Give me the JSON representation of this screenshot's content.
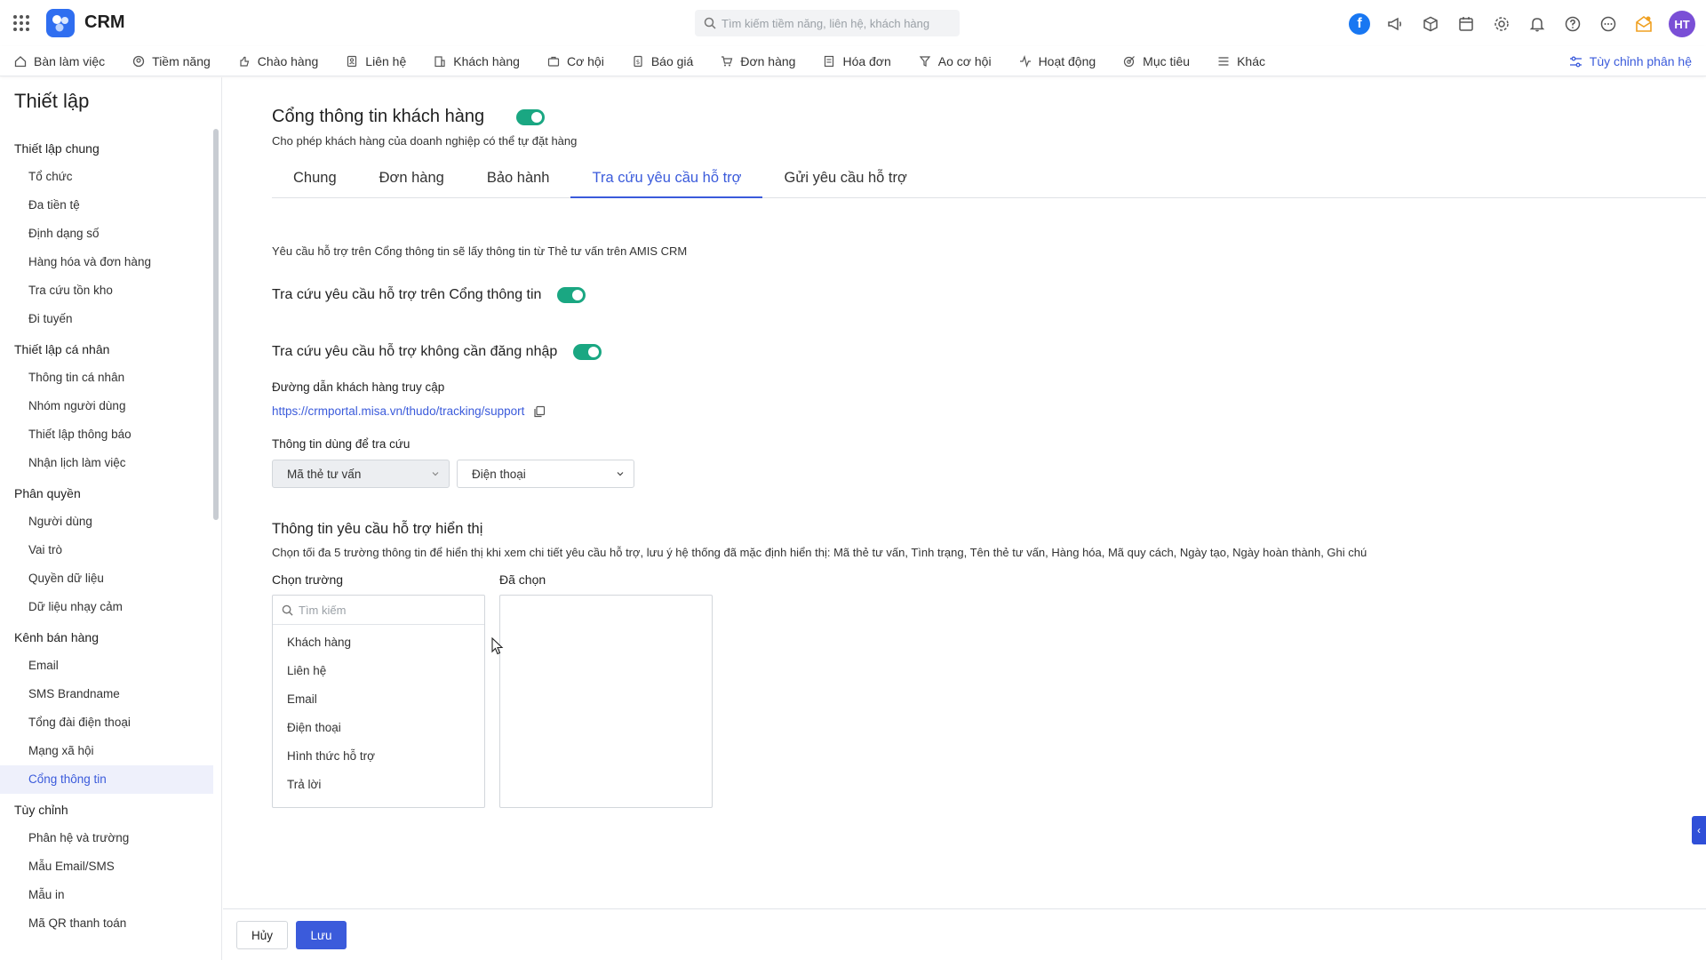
{
  "app": {
    "title": "CRM"
  },
  "search": {
    "placeholder": "Tìm kiếm tiềm năng, liên hệ, khách hàng"
  },
  "user": {
    "initials": "HT"
  },
  "colors": {
    "accent": "#3b5bdb",
    "toggle_on": "#1aa782",
    "brand": "#2f6ef0"
  },
  "nav": {
    "items": [
      {
        "label": "Bàn làm việc",
        "icon": "home-icon"
      },
      {
        "label": "Tiềm năng",
        "icon": "target-icon"
      },
      {
        "label": "Chào hàng",
        "icon": "hand-icon"
      },
      {
        "label": "Liên hệ",
        "icon": "contact-icon"
      },
      {
        "label": "Khách hàng",
        "icon": "building-icon"
      },
      {
        "label": "Cơ hội",
        "icon": "briefcase-icon"
      },
      {
        "label": "Báo giá",
        "icon": "quote-icon"
      },
      {
        "label": "Đơn hàng",
        "icon": "cart-icon"
      },
      {
        "label": "Hóa đơn",
        "icon": "invoice-icon"
      },
      {
        "label": "Ao cơ hội",
        "icon": "funnel-icon"
      },
      {
        "label": "Hoạt động",
        "icon": "activity-icon"
      },
      {
        "label": "Mục tiêu",
        "icon": "goal-icon"
      },
      {
        "label": "Khác",
        "icon": "menu-icon"
      }
    ],
    "customize_label": "Tùy chỉnh phân hệ"
  },
  "sidebar": {
    "title": "Thiết lập",
    "groups": [
      {
        "label": "Thiết lập chung",
        "items": [
          "Tổ chức",
          "Đa tiền tệ",
          "Định dạng số",
          "Hàng hóa và đơn hàng",
          "Tra cứu tồn kho",
          "Đi tuyến"
        ]
      },
      {
        "label": "Thiết lập cá nhân",
        "items": [
          "Thông tin cá nhân",
          "Nhóm người dùng",
          "Thiết lập thông báo",
          "Nhận lịch làm việc"
        ]
      },
      {
        "label": "Phân quyền",
        "items": [
          "Người dùng",
          "Vai trò",
          "Quyền dữ liệu",
          "Dữ liệu nhạy cảm"
        ]
      },
      {
        "label": "Kênh bán hàng",
        "items": [
          "Email",
          "SMS Brandname",
          "Tổng đài điện thoại",
          "Mạng xã hội",
          "Cổng thông tin"
        ]
      },
      {
        "label": "Tùy chỉnh",
        "items": [
          "Phân hệ và trường",
          "Mẫu Email/SMS",
          "Mẫu in",
          "Mã QR thanh toán"
        ]
      }
    ],
    "active_item": "Cổng thông tin"
  },
  "main": {
    "title": "Cổng thông tin khách hàng",
    "subtitle": "Cho phép khách hàng của doanh nghiệp có thể tự đặt hàng",
    "portal_enabled": true,
    "tabs": [
      "Chung",
      "Đơn hàng",
      "Bảo hành",
      "Tra cứu yêu cầu hỗ trợ",
      "Gửi yêu cầu hỗ trợ"
    ],
    "active_tab": "Tra cứu yêu cầu hỗ trợ",
    "description": "Yêu cầu hỗ trợ trên Cổng thông tin sẽ lấy thông tin từ Thẻ tư vấn trên AMIS CRM",
    "lookup_on_portal": {
      "label": "Tra cứu yêu cầu hỗ trợ trên Cổng thông tin",
      "enabled": true
    },
    "lookup_no_login": {
      "label": "Tra cứu yêu cầu hỗ trợ không cần đăng nhập",
      "enabled": true
    },
    "access_url_label": "Đường dẫn khách hàng truy cập",
    "access_url": "https://crmportal.misa.vn/thudo/tracking/support",
    "lookup_info_label": "Thông tin dùng để tra cứu",
    "lookup_field_1": "Mã thẻ tư vấn",
    "lookup_field_2": "Điện thoại",
    "display_section_title": "Thông tin yêu cầu hỗ trợ hiển thị",
    "display_section_desc": "Chọn tối đa 5 trường thông tin để hiển thị khi xem chi tiết yêu cầu hỗ trợ, lưu ý hệ thống đã mặc định hiển thị: Mã thẻ tư vấn, Tình trạng, Tên thẻ tư vấn, Hàng hóa, Mã quy cách, Ngày tạo, Ngày hoàn thành, Ghi chú",
    "choose_label": "Chọn trường",
    "chosen_label": "Đã chọn",
    "field_search_placeholder": "Tìm kiếm",
    "available_fields": [
      "Khách hàng",
      "Liên hệ",
      "Email",
      "Điện thoại",
      "Hình thức hỗ trợ",
      "Trả lời"
    ],
    "selected_fields": []
  },
  "footer": {
    "cancel_label": "Hủy",
    "save_label": "Lưu"
  }
}
